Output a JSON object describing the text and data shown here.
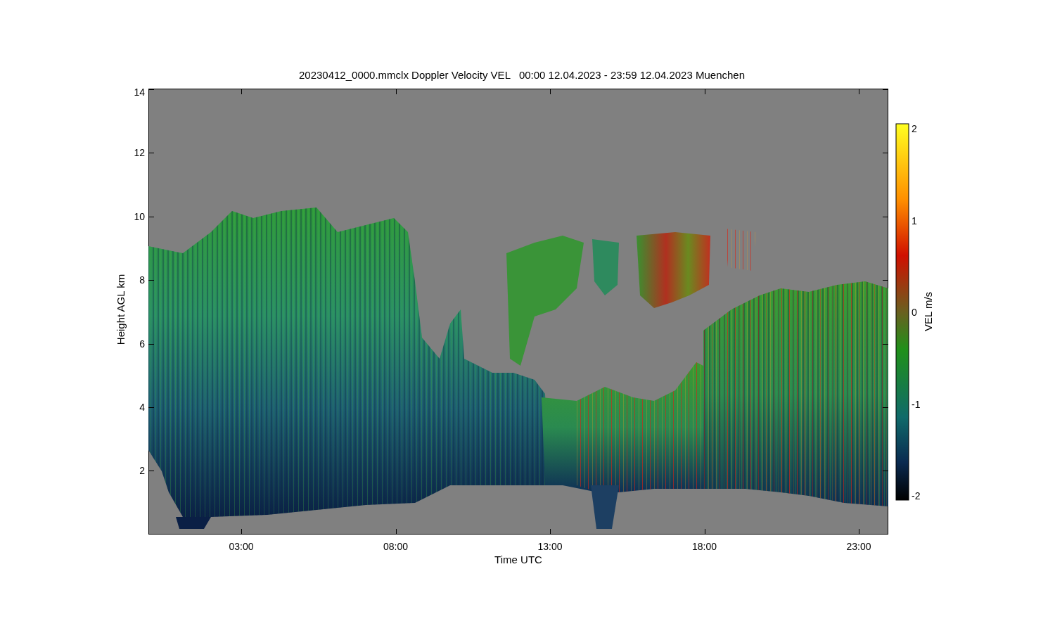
{
  "title": "20230412_0000.mmclx Doppler Velocity VEL   00:00 12.04.2023 - 23:59 12.04.2023 Muenchen",
  "y_axis": {
    "label": "Height AGL km",
    "ticks": [
      "14",
      "12",
      "10",
      "8",
      "6",
      "4",
      "2"
    ]
  },
  "x_axis": {
    "label": "Time UTC",
    "ticks": [
      "03:00",
      "08:00",
      "13:00",
      "18:00",
      "23:00"
    ]
  },
  "colorbar": {
    "label": "VEL m/s",
    "ticks": [
      "2",
      "1",
      "0",
      "-1",
      "-2"
    ]
  }
}
